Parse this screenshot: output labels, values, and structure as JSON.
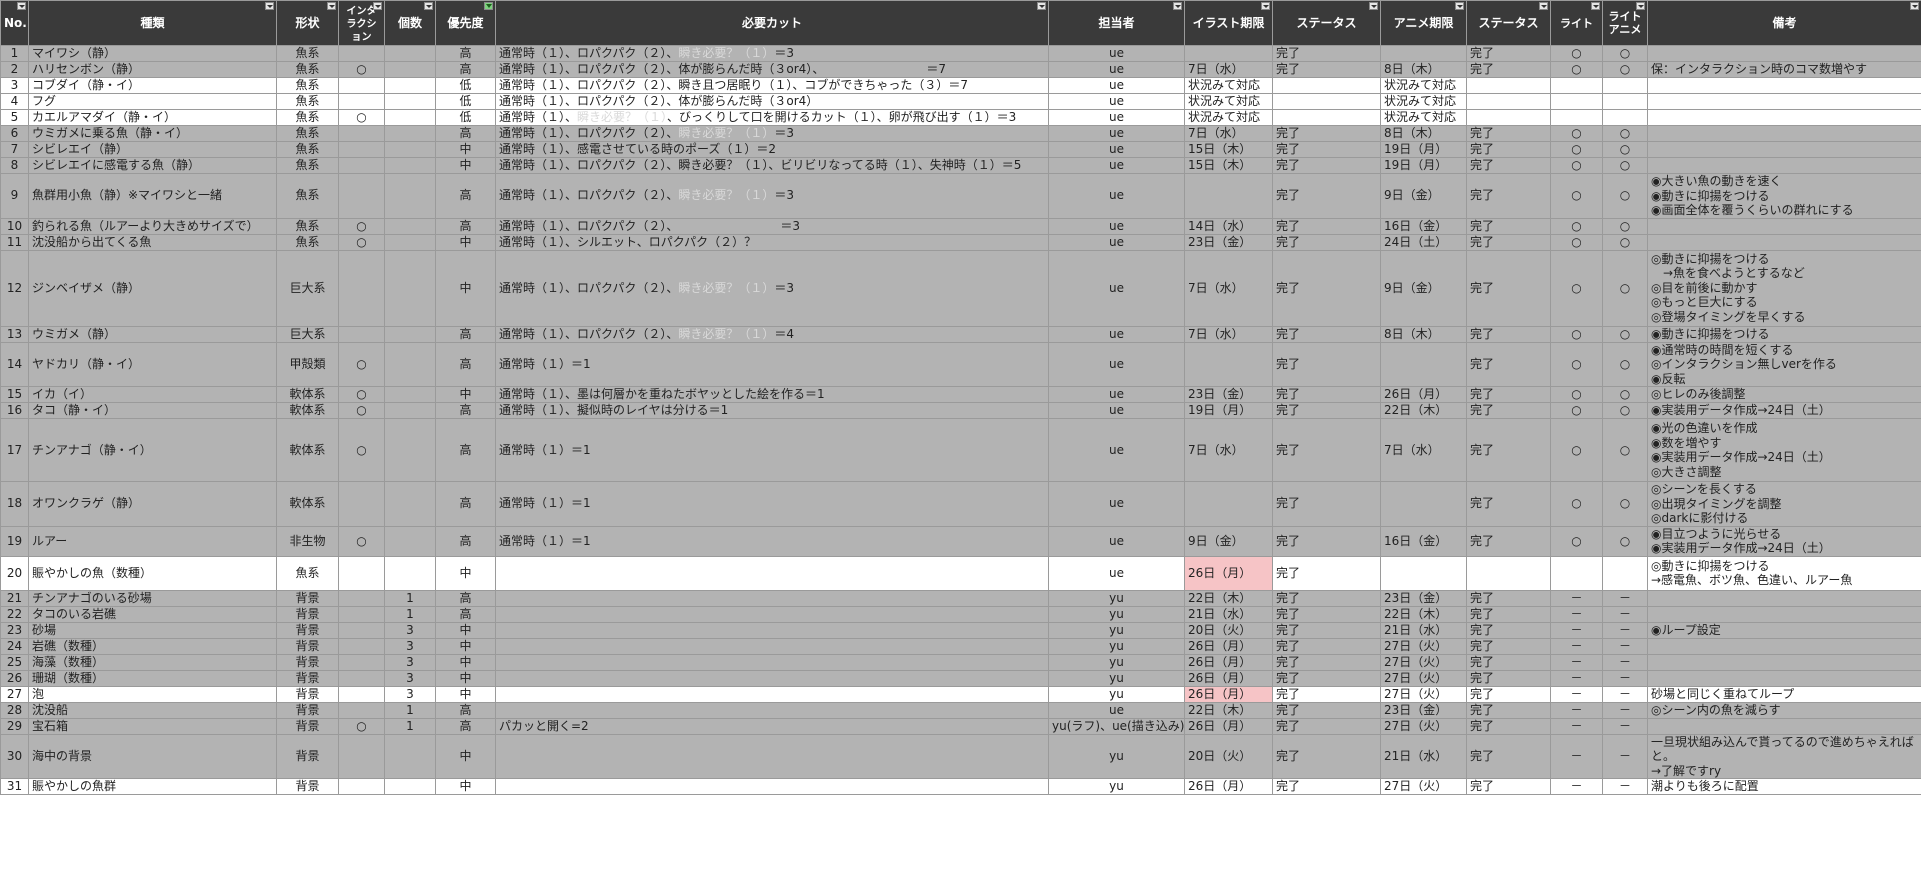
{
  "headers": [
    "No.",
    "種類",
    "形状",
    "インタラクション",
    "個数",
    "優先度",
    "必要カット",
    "担当者",
    "イラスト期限",
    "ステータス",
    "アニメ期限",
    "ステータス",
    "ライト",
    "ライトアニメ",
    "備考"
  ],
  "rows": [
    {
      "no": "1",
      "type": "マイワシ（静）",
      "shape": "魚系",
      "inter": "",
      "count": "",
      "prio": "高",
      "cut": "通常時（１）、ロパクパク（２）、",
      "cut_dim": "瞬き必要？（１）",
      "cut_end": "＝3",
      "owner": "ue",
      "illust": "",
      "st1": "完了",
      "anime": "",
      "st2": "完了",
      "light": "○",
      "lanime": "○",
      "note": ""
    },
    {
      "no": "2",
      "type": "ハリセンボン（静）",
      "shape": "魚系",
      "inter": "○",
      "count": "",
      "prio": "高",
      "cut": "通常時（１）、ロパクパク（２）、体が膨らんだ時（３or4）、　　　　　　　　　＝7",
      "cut_dim": "",
      "cut_end": "",
      "owner": "ue",
      "illust": "7日（水）",
      "st1": "完了",
      "anime": "8日（木）",
      "st2": "完了",
      "light": "○",
      "lanime": "○",
      "note": "保：インタラクション時のコマ数増やす"
    },
    {
      "no": "3",
      "type": "コブダイ（静・イ）",
      "shape": "魚系",
      "inter": "",
      "count": "",
      "prio": "低",
      "cut": "通常時（１）、ロパクパク（２）、瞬き且つ居眠り（１）、コブができちゃった（３）＝7",
      "cut_dim": "",
      "cut_end": "",
      "owner": "ue",
      "illust": "状況みて対応",
      "st1": "",
      "anime": "状況みて対応",
      "st2": "",
      "light": "",
      "lanime": "",
      "note": ""
    },
    {
      "no": "4",
      "type": "フグ",
      "shape": "魚系",
      "inter": "",
      "count": "",
      "prio": "低",
      "cut": "通常時（１）、ロパクパク（２）、体が膨らんだ時（３or4）",
      "cut_dim": "",
      "cut_end": "",
      "owner": "ue",
      "illust": "状況みて対応",
      "st1": "",
      "anime": "状況みて対応",
      "st2": "",
      "light": "",
      "lanime": "",
      "note": ""
    },
    {
      "no": "5",
      "type": "カエルアマダイ（静・イ）",
      "shape": "魚系",
      "inter": "○",
      "count": "",
      "prio": "低",
      "cut": "通常時（１）、",
      "cut_dim": "瞬き必要？（１）",
      "cut_end": "、びっくりして口を開けるカット（１）、卵が飛び出す（１）＝3",
      "owner": "ue",
      "illust": "状況みて対応",
      "st1": "",
      "anime": "状況みて対応",
      "st2": "",
      "light": "",
      "lanime": "",
      "note": ""
    },
    {
      "no": "6",
      "type": "ウミガメに乗る魚（静・イ）",
      "shape": "魚系",
      "inter": "",
      "count": "",
      "prio": "高",
      "cut": "通常時（１）、ロパクパク（２）、",
      "cut_dim": "瞬き必要？（１）",
      "cut_end": "＝3",
      "owner": "ue",
      "illust": "7日（水）",
      "st1": "完了",
      "anime": "8日（木）",
      "st2": "完了",
      "light": "○",
      "lanime": "○",
      "note": ""
    },
    {
      "no": "7",
      "type": "シビレエイ（静）",
      "shape": "魚系",
      "inter": "",
      "count": "",
      "prio": "中",
      "cut": "通常時（１）、感電させている時のポーズ（１）＝2",
      "cut_dim": "",
      "cut_end": "",
      "owner": "ue",
      "illust": "15日（木）",
      "st1": "完了",
      "anime": "19日（月）",
      "st2": "完了",
      "light": "○",
      "lanime": "○",
      "note": ""
    },
    {
      "no": "8",
      "type": "シビレエイに感電する魚（静）",
      "shape": "魚系",
      "inter": "",
      "count": "",
      "prio": "中",
      "cut": "通常時（１）、ロパクパク（２）、瞬き必要？（１）、ビリビリなってる時（１）、失神時（１）＝5",
      "cut_dim": "",
      "cut_end": "",
      "owner": "ue",
      "illust": "15日（木）",
      "st1": "完了",
      "anime": "19日（月）",
      "st2": "完了",
      "light": "○",
      "lanime": "○",
      "note": ""
    },
    {
      "no": "9",
      "type": "魚群用小魚（静）※マイワシと一緒",
      "shape": "魚系",
      "inter": "",
      "count": "",
      "prio": "高",
      "cut": "通常時（１）、ロパクパク（２）、",
      "cut_dim": "瞬き必要？（１）",
      "cut_end": "＝3",
      "owner": "ue",
      "illust": "",
      "st1": "完了",
      "anime": "9日（金）",
      "st2": "完了",
      "light": "○",
      "lanime": "○",
      "note": "◉大きい魚の動きを速く\n◉動きに抑揚をつける\n◉画面全体を覆うくらいの群れにする"
    },
    {
      "no": "10",
      "type": "釣られる魚（ルアーより大きめサイズで）",
      "shape": "魚系",
      "inter": "○",
      "count": "",
      "prio": "高",
      "cut": "通常時（１）、ロパクパク（２）、　　　　　　　　　＝3",
      "cut_dim": "",
      "cut_end": "",
      "owner": "ue",
      "illust": "14日（水）",
      "st1": "完了",
      "anime": "16日（金）",
      "st2": "完了",
      "light": "○",
      "lanime": "○",
      "note": ""
    },
    {
      "no": "11",
      "type": "沈没船から出てくる魚",
      "shape": "魚系",
      "inter": "○",
      "count": "",
      "prio": "中",
      "cut": "通常時（１）、シルエット、ロパクパク（２）？",
      "cut_dim": "",
      "cut_end": "",
      "owner": "ue",
      "illust": "23日（金）",
      "st1": "完了",
      "anime": "24日（土）",
      "st2": "完了",
      "light": "○",
      "lanime": "○",
      "note": ""
    },
    {
      "no": "12",
      "type": "ジンベイザメ（静）",
      "shape": "巨大系",
      "inter": "",
      "count": "",
      "prio": "中",
      "cut": "通常時（１）、ロパクパク（２）、",
      "cut_dim": "瞬き必要？（１）",
      "cut_end": "＝3",
      "owner": "ue",
      "illust": "7日（水）",
      "st1": "完了",
      "anime": "9日（金）",
      "st2": "完了",
      "light": "○",
      "lanime": "○",
      "note": "◎動きに抑揚をつける\n　→魚を食べようとするなど\n◎目を前後に動かす\n◎もっと巨大にする\n◎登場タイミングを早くする"
    },
    {
      "no": "13",
      "type": "ウミガメ（静）",
      "shape": "巨大系",
      "inter": "",
      "count": "",
      "prio": "高",
      "cut": "通常時（１）、ロパクパク（２）、",
      "cut_dim": "瞬き必要？（１）",
      "cut_end": "＝4",
      "owner": "ue",
      "illust": "7日（水）",
      "st1": "完了",
      "anime": "8日（木）",
      "st2": "完了",
      "light": "○",
      "lanime": "○",
      "note": "◉動きに抑揚をつける"
    },
    {
      "no": "14",
      "type": "ヤドカリ（静・イ）",
      "shape": "甲殻類",
      "inter": "○",
      "count": "",
      "prio": "高",
      "cut": "通常時（１）＝1",
      "cut_dim": "",
      "cut_end": "",
      "owner": "ue",
      "illust": "",
      "st1": "完了",
      "anime": "",
      "st2": "完了",
      "light": "○",
      "lanime": "○",
      "note": "◉通常時の時間を短くする\n◎インタラクション無しverを作る\n◉反転"
    },
    {
      "no": "15",
      "type": "イカ（イ）",
      "shape": "軟体系",
      "inter": "○",
      "count": "",
      "prio": "中",
      "cut": "通常時（１）、墨は何層かを重ねたボヤッとした絵を作る＝1",
      "cut_dim": "",
      "cut_end": "",
      "owner": "ue",
      "illust": "23日（金）",
      "st1": "完了",
      "anime": "26日（月）",
      "st2": "完了",
      "light": "○",
      "lanime": "○",
      "note": "◎ヒレのみ後調整"
    },
    {
      "no": "16",
      "type": "タコ（静・イ）",
      "shape": "軟体系",
      "inter": "○",
      "count": "",
      "prio": "高",
      "cut": "通常時（１）、擬似時のレイヤは分ける＝1",
      "cut_dim": "",
      "cut_end": "",
      "owner": "ue",
      "illust": "19日（月）",
      "st1": "完了",
      "anime": "22日（木）",
      "st2": "完了",
      "light": "○",
      "lanime": "○",
      "note": "◉実装用データ作成→24日（土）"
    },
    {
      "no": "17",
      "type": "チンアナゴ（静・イ）",
      "shape": "軟体系",
      "inter": "○",
      "count": "",
      "prio": "高",
      "cut": "通常時（１）＝1",
      "cut_dim": "",
      "cut_end": "",
      "owner": "ue",
      "illust": "7日（水）",
      "st1": "完了",
      "anime": "7日（水）",
      "st2": "完了",
      "light": "○",
      "lanime": "○",
      "note": "◉光の色違いを作成\n◉数を増やす\n◉実装用データ作成→24日（土）\n◎大きさ調整"
    },
    {
      "no": "18",
      "type": "オワンクラゲ（静）",
      "shape": "軟体系",
      "inter": "",
      "count": "",
      "prio": "高",
      "cut": "通常時（１）＝1",
      "cut_dim": "",
      "cut_end": "",
      "owner": "ue",
      "illust": "",
      "st1": "完了",
      "anime": "",
      "st2": "完了",
      "light": "○",
      "lanime": "○",
      "note": "◎シーンを長くする\n◎出現タイミングを調整\n◎darkに影付ける"
    },
    {
      "no": "19",
      "type": "ルアー",
      "shape": "非生物",
      "inter": "○",
      "count": "",
      "prio": "高",
      "cut": "通常時（１）＝1",
      "cut_dim": "",
      "cut_end": "",
      "owner": "ue",
      "illust": "9日（金）",
      "st1": "完了",
      "anime": "16日（金）",
      "st2": "完了",
      "light": "○",
      "lanime": "○",
      "note": "◉目立つように光らせる\n◉実装用データ作成→24日（土）"
    },
    {
      "no": "20",
      "type": "賑やかしの魚（数種）",
      "shape": "魚系",
      "inter": "",
      "count": "",
      "prio": "中",
      "cut": "",
      "cut_dim": "",
      "cut_end": "",
      "owner": "ue",
      "illust": "26日（月）",
      "st1": "完了",
      "anime": "",
      "st2": "",
      "light": "",
      "lanime": "",
      "note": "◎動きに抑揚をつける\n→感電魚、ボツ魚、色違い、ルアー魚"
    },
    {
      "no": "21",
      "type": "チンアナゴのいる砂場",
      "shape": "背景",
      "inter": "",
      "count": "1",
      "prio": "高",
      "cut": "",
      "cut_dim": "",
      "cut_end": "",
      "owner": "yu",
      "illust": "22日（木）",
      "st1": "完了",
      "anime": "23日（金）",
      "st2": "完了",
      "light": "－",
      "lanime": "－",
      "note": ""
    },
    {
      "no": "22",
      "type": "タコのいる岩礁",
      "shape": "背景",
      "inter": "",
      "count": "1",
      "prio": "高",
      "cut": "",
      "cut_dim": "",
      "cut_end": "",
      "owner": "yu",
      "illust": "21日（水）",
      "st1": "完了",
      "anime": "22日（木）",
      "st2": "完了",
      "light": "－",
      "lanime": "－",
      "note": ""
    },
    {
      "no": "23",
      "type": "砂場",
      "shape": "背景",
      "inter": "",
      "count": "3",
      "prio": "中",
      "cut": "",
      "cut_dim": "",
      "cut_end": "",
      "owner": "yu",
      "illust": "20日（火）",
      "st1": "完了",
      "anime": "21日（水）",
      "st2": "完了",
      "light": "－",
      "lanime": "－",
      "note": "◉ループ設定"
    },
    {
      "no": "24",
      "type": "岩礁（数種）",
      "shape": "背景",
      "inter": "",
      "count": "3",
      "prio": "中",
      "cut": "",
      "cut_dim": "",
      "cut_end": "",
      "owner": "yu",
      "illust": "26日（月）",
      "st1": "完了",
      "anime": "27日（火）",
      "st2": "完了",
      "light": "－",
      "lanime": "－",
      "note": ""
    },
    {
      "no": "25",
      "type": "海藻（数種）",
      "shape": "背景",
      "inter": "",
      "count": "3",
      "prio": "中",
      "cut": "",
      "cut_dim": "",
      "cut_end": "",
      "owner": "yu",
      "illust": "26日（月）",
      "st1": "完了",
      "anime": "27日（火）",
      "st2": "完了",
      "light": "－",
      "lanime": "－",
      "note": ""
    },
    {
      "no": "26",
      "type": "珊瑚（数種）",
      "shape": "背景",
      "inter": "",
      "count": "3",
      "prio": "中",
      "cut": "",
      "cut_dim": "",
      "cut_end": "",
      "owner": "yu",
      "illust": "26日（月）",
      "st1": "完了",
      "anime": "27日（火）",
      "st2": "完了",
      "light": "－",
      "lanime": "－",
      "note": ""
    },
    {
      "no": "27",
      "type": "泡",
      "shape": "背景",
      "inter": "",
      "count": "3",
      "prio": "中",
      "cut": "",
      "cut_dim": "",
      "cut_end": "",
      "owner": "yu",
      "illust": "26日（月）",
      "st1": "完了",
      "anime": "27日（火）",
      "st2": "完了",
      "light": "－",
      "lanime": "－",
      "note": "砂場と同じく重ねてループ"
    },
    {
      "no": "28",
      "type": "沈没船",
      "shape": "背景",
      "inter": "",
      "count": "1",
      "prio": "高",
      "cut": "",
      "cut_dim": "",
      "cut_end": "",
      "owner": "ue",
      "illust": "22日（木）",
      "st1": "完了",
      "anime": "23日（金）",
      "st2": "完了",
      "light": "－",
      "lanime": "－",
      "note": "◎シーン内の魚を減らす"
    },
    {
      "no": "29",
      "type": "宝石箱",
      "shape": "背景",
      "inter": "○",
      "count": "1",
      "prio": "高",
      "cut": "パカッと開く=2",
      "cut_dim": "",
      "cut_end": "",
      "owner": "yu(ラフ)、ue(描き込み)",
      "illust": "26日（月）",
      "st1": "完了",
      "anime": "27日（火）",
      "st2": "完了",
      "light": "－",
      "lanime": "－",
      "note": ""
    },
    {
      "no": "30",
      "type": "海中の背景",
      "shape": "背景",
      "inter": "",
      "count": "",
      "prio": "中",
      "cut": "",
      "cut_dim": "",
      "cut_end": "",
      "owner": "yu",
      "illust": "20日（火）",
      "st1": "完了",
      "anime": "21日（水）",
      "st2": "完了",
      "light": "－",
      "lanime": "－",
      "note": "一旦現状組み込んで貰ってるので進めちゃえればと。\n→了解ですry"
    },
    {
      "no": "31",
      "type": "賑やかしの魚群",
      "shape": "背景",
      "inter": "",
      "count": "",
      "prio": "中",
      "cut": "",
      "cut_dim": "",
      "cut_end": "",
      "owner": "yu",
      "illust": "26日（月）",
      "st1": "完了",
      "anime": "27日（火）",
      "st2": "完了",
      "light": "－",
      "lanime": "－",
      "note": "潮よりも後ろに配置"
    }
  ],
  "colors": {
    "header_bg": "#3a3a3a",
    "row_gray": "#b3b3b3",
    "row_white": "#ffffff",
    "highlight": "#f6c4c6"
  }
}
